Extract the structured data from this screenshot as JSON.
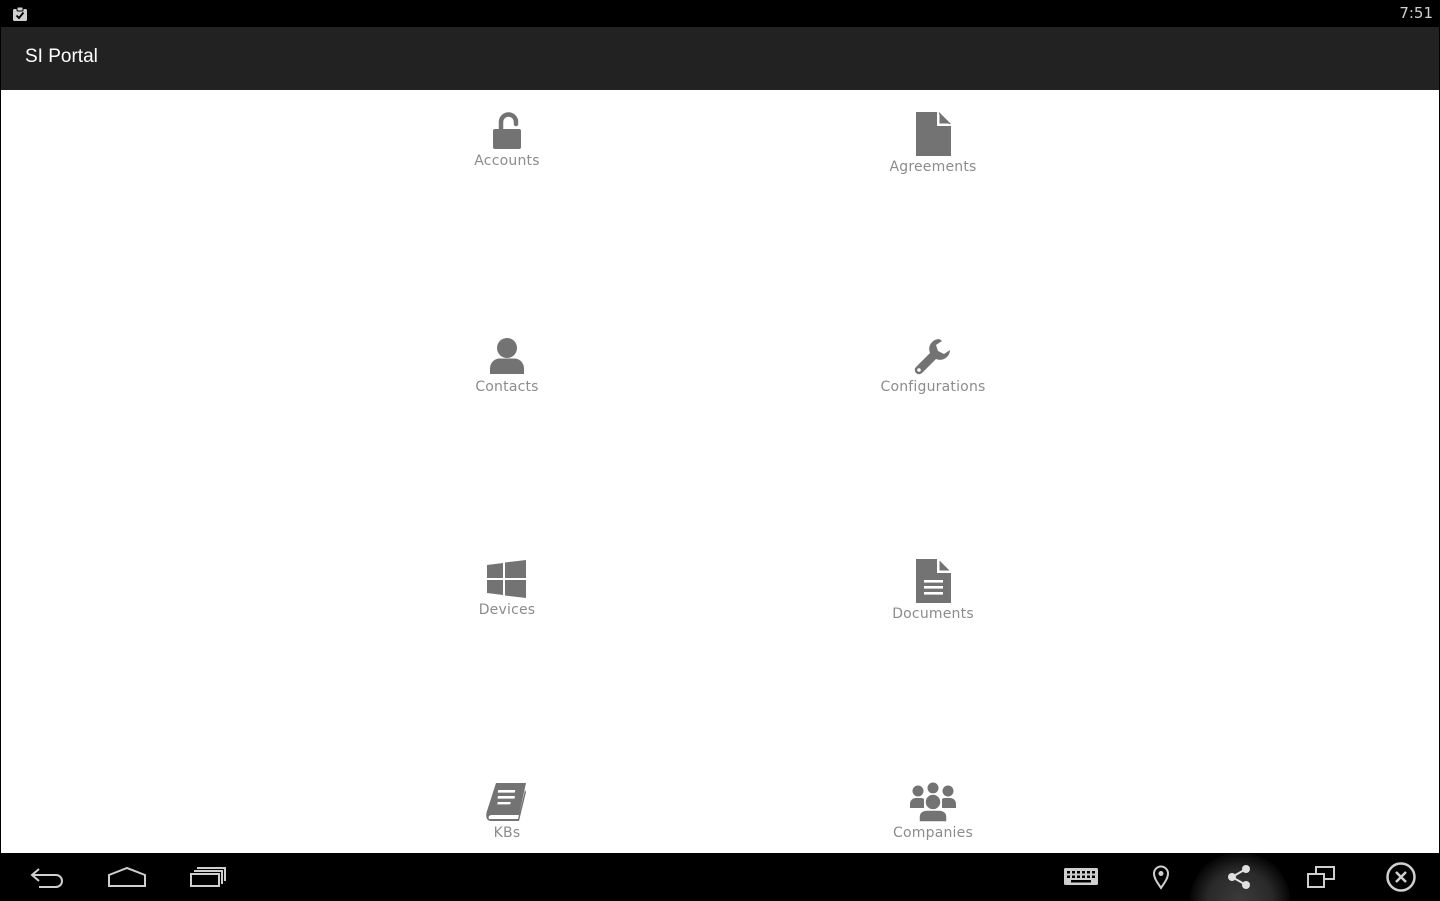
{
  "status_bar": {
    "notification_icon": "clipboard-check-icon",
    "time": "7:51"
  },
  "action_bar": {
    "title": "SI Portal"
  },
  "tiles": [
    {
      "label": "Accounts",
      "icon": "unlock-icon"
    },
    {
      "label": "Agreements",
      "icon": "file-icon"
    },
    {
      "label": "Contacts",
      "icon": "user-icon"
    },
    {
      "label": "Configurations",
      "icon": "wrench-icon"
    },
    {
      "label": "Devices",
      "icon": "windows-icon"
    },
    {
      "label": "Documents",
      "icon": "document-text-icon"
    },
    {
      "label": "KBs",
      "icon": "book-icon"
    },
    {
      "label": "Companies",
      "icon": "group-icon"
    }
  ],
  "nav_bar": {
    "left": [
      "back-icon",
      "home-icon",
      "recent-apps-icon"
    ],
    "right": [
      "keyboard-icon",
      "location-pin-icon",
      "share-icon",
      "screen-rotate-icon",
      "close-circle-icon"
    ]
  },
  "colors": {
    "icon_gray": "#737373",
    "label_gray": "#8c8c8c",
    "action_bar": "#222222",
    "system_bar": "#000000"
  }
}
